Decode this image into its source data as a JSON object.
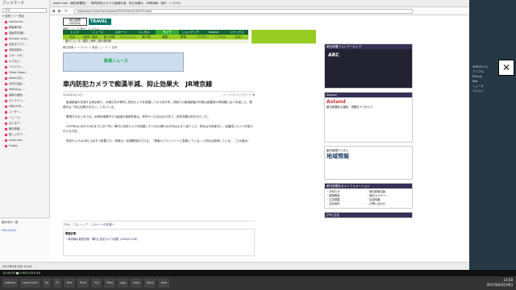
{
  "sidebar": {
    "title": "ブックマーク",
    "search_placeholder": "検索",
    "folder": "▾ 全般ツリー表示",
    "items": [
      "sokuho bu...",
      "新幹線7時...",
      "高画質(情報...",
      "Amazon.co.jp...",
      "安全なスクリ...",
      "安保法制の...",
      "スポーツの...",
      "キスなど...",
      "バラエティ...",
      "3Sabc.Separ...",
      "Nalifeの日...",
      "台湾の会話...",
      "WIRED.jp...",
      "最新の産経...",
      "オンライン...",
      "ISBN:978...",
      "ユーザー...",
      "ニュース...",
      "はてなブ...",
      "朝日新聞...",
      "新しいタブ...",
      "asahi.com",
      "Firefox"
    ],
    "bottom_label": "読み中の一覧",
    "bottom_link": "http://twitt"
  },
  "tabbar": {
    "text": "asahi.com（朝日新聞社）：車内防犯カメラで痴漢半減、抑止効果大　JR埼京線 - 旅行・トラベル"
  },
  "url": "www.asahi.com/travel/news/TKY201004110075.html",
  "header": {
    "logo": "朝日新聞 DIGITAL",
    "section": "TRAVEL",
    "subtitle": "最新ニュース 旅行・トラベル",
    "nav1": [
      "トップ",
      "ニュース",
      "スポーツ",
      "エンタメ",
      "ライフ",
      "ショッピング",
      "Astand",
      "トピックス"
    ],
    "nav2": [
      "社会",
      "経済・総合",
      "食と料理",
      "ファッション",
      "乗り物",
      "健康",
      "教育",
      "デジタル",
      "トラベル",
      "住まい"
    ],
    "nav3": "旅行ニュース | 国内 | 海外 | 旅の便利帳"
  },
  "breadcrumb": "朝日新聞 > トラベル > 鉄道ニュース > 記事",
  "ad": {
    "label": "鉄道ニュース"
  },
  "article": {
    "title": "車内防犯カメラで痴漢半減、抑止効果大　JR埼京線",
    "date": "2010年4月11日",
    "meta_right": "ソーシャルブックマーク ▼",
    "paragraphs": [
      "痴漢被害の多発する埼京線で、JR東日本が車内に防犯カメラを設置してから約半年。同線での痴漢被害の件数は設置前の同時期に比べ半減した。警視庁は「抑止効果が大きい」とみている。",
      "警視庁のまとめでは、JR埼京線車内での痴漢の検挙件数は、昨年9〜12月は計24件で、前年同期の約半分だった。",
      "2009年は1月から8月までに計73件。車内に防犯カメラを設置した12月以降の月平均は大きく減少した。同社は今年度中に、全編成にカメラを取り付ける方針。",
      "防犯カメラは1両に4台ずつ設置され、映像は一定期間保存される。「乗客のプライバシーに配慮している」と同社は説明している。（三木重太）"
    ],
    "share": "アサヒ・コム トップ　このページの先頭へ",
    "related_title": "関連記事",
    "related_item": "・埼京線の痴漢対策、車内に防犯カメラ設置（2009/12/26）"
  },
  "right": {
    "arc_head": "朝日新聞フォトアーカイブ",
    "arc_text": "ARC",
    "astand_head": "Astand",
    "astand_logo": "Astand",
    "astand_text": "朝日新聞社の雑誌・書籍をデジタルで",
    "chiiki_head": "朝日新聞デジタル",
    "chiiki_title": "地域情報",
    "info_head": "朝日新聞社のインフォメーション",
    "info": [
      "・お知らせ",
      "・朝日新聞出版",
      "・新聞購読",
      "・朝日カルチャー",
      "・広告掲載",
      "・採用情報",
      "・会社案内",
      "・お問い合わせ"
    ],
    "blog_head": "[PR] 広告"
  },
  "dark_panel": {
    "lines": [
      "#9500ドル",
      "アップル",
      "iPhone",
      "Mac",
      "ニュース",
      "コメント"
    ]
  },
  "statusbar": "2017年3月19日 12:44",
  "sysbar": "12:44:29 ■ 0.95 0.43 0.40",
  "taskbar": {
    "items": [
      "sidebar",
      "asahi.com",
      "Tw",
      "FF",
      "Text",
      "Term",
      "VLC",
      "Files",
      "app",
      "note",
      "docs",
      "web"
    ],
    "time": "13:50",
    "date": "2017年03月19日"
  }
}
